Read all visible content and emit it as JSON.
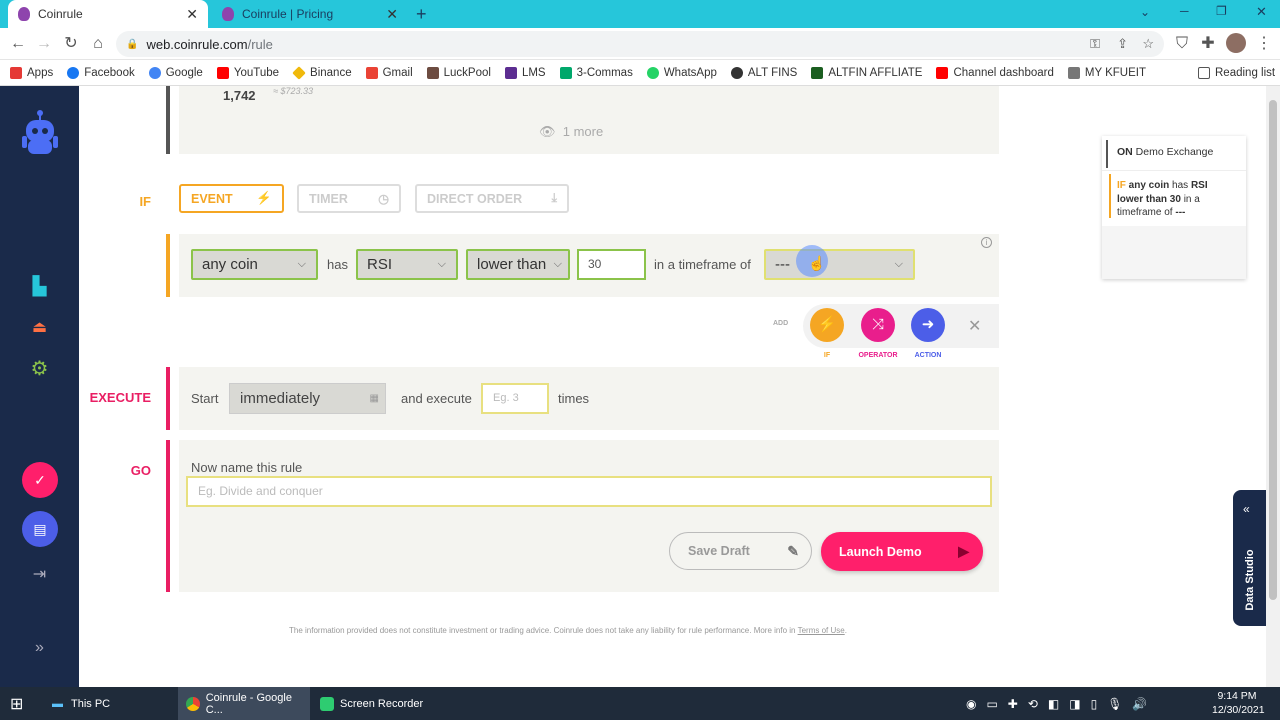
{
  "tabs": [
    {
      "title": "Coinrule",
      "active": true
    },
    {
      "title": "Coinrule | Pricing",
      "active": false
    }
  ],
  "url": {
    "host": "web.coinrule.com",
    "path": "/rule"
  },
  "bookmarks": [
    "Apps",
    "Facebook",
    "Google",
    "YouTube",
    "Binance",
    "Gmail",
    "LuckPool",
    "LMS",
    "3-Commas",
    "WhatsApp",
    "ALT FINS",
    "ALTFIN AFFLIATE",
    "Channel dashboard",
    "MY KFUEIT"
  ],
  "reading_list": "Reading list",
  "top_card": {
    "value": "1,742",
    "sub": "≈ $723.33",
    "more": "1 more"
  },
  "if_section": {
    "label": "IF",
    "tabs": {
      "event": "EVENT",
      "timer": "TIMER",
      "direct": "DIRECT ORDER"
    },
    "coin": "any coin",
    "has": "has",
    "indicator": "RSI",
    "comparator": "lower than",
    "value": "30",
    "timeframe_text": "in a timeframe of",
    "timeframe": "---"
  },
  "add_row": {
    "add": "ADD",
    "if": "IF",
    "operator": "OPERATOR",
    "action": "ACTION"
  },
  "execute": {
    "label": "EXECUTE",
    "start": "Start",
    "when": "immediately",
    "and_execute": "and execute",
    "times_placeholder": "Eg. 3",
    "times": "times"
  },
  "go": {
    "label": "GO",
    "name_label": "Now name this rule",
    "name_placeholder": "Eg. Divide and conquer",
    "save": "Save Draft",
    "launch": "Launch Demo"
  },
  "footer": {
    "text": "The information provided does not constitute investment or trading advice. Coinrule does not take any liability for rule performance. More info in ",
    "link": "Terms of Use",
    "end": "."
  },
  "summary": {
    "on": "ON",
    "exchange": "Demo Exchange",
    "if": "IF",
    "coin": "any coin",
    "has": "has",
    "indicator": "RSI",
    "cond": "lower than 30",
    "in": "in a",
    "timeframe_of": "timeframe of",
    "tf": "---"
  },
  "data_studio": "Data Studio",
  "taskbar": {
    "this_pc": "This PC",
    "chrome": "Coinrule - Google C...",
    "recorder": "Screen Recorder",
    "time": "9:14 PM",
    "date": "12/30/2021"
  },
  "colors": {
    "accent": "#f5a623",
    "pink": "#ff1f6b",
    "operator": "#e91e8c",
    "action": "#4c5ee8",
    "rail": "#1a2a4a"
  }
}
